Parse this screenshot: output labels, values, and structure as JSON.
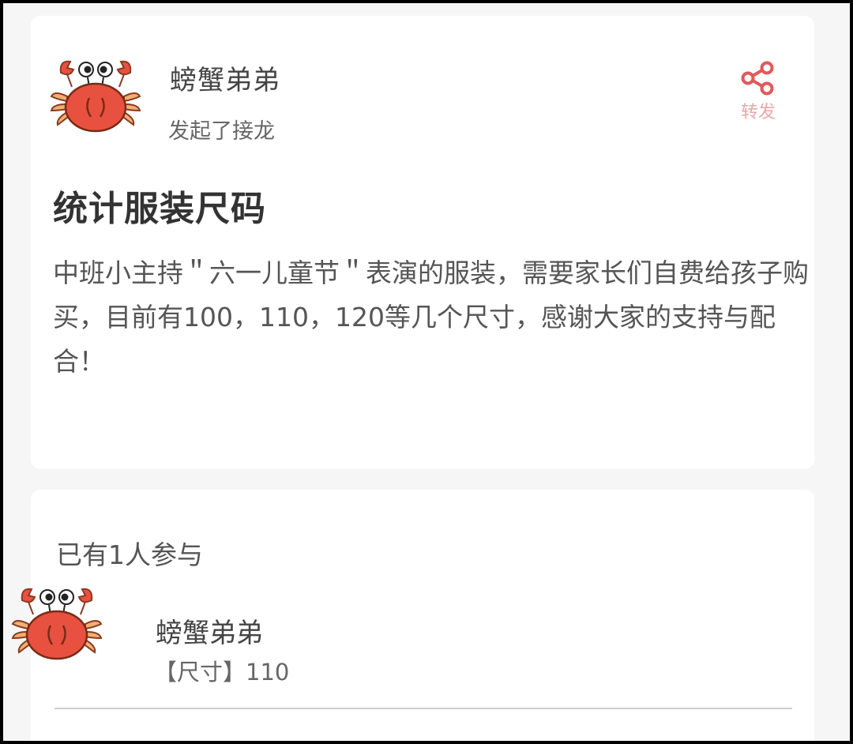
{
  "post": {
    "author_name": "螃蟹弟弟",
    "action_text": "发起了接龙",
    "share_label": "转发",
    "title": "统计服装尺码",
    "description": "中班小主持＂六一儿童节＂表演的服装，需要家长们自费给孩子购买，目前有100，110，120等几个尺寸，感谢大家的支持与配合！"
  },
  "participants": {
    "count_text": "已有1人参与",
    "items": [
      {
        "name": "螃蟹弟弟",
        "detail": "【尺寸】110"
      }
    ]
  },
  "icons": {
    "avatar": "crab-avatar-icon",
    "share": "share-icon"
  },
  "colors": {
    "share_icon": "#e05a5a",
    "crab_body": "#e8513f"
  }
}
